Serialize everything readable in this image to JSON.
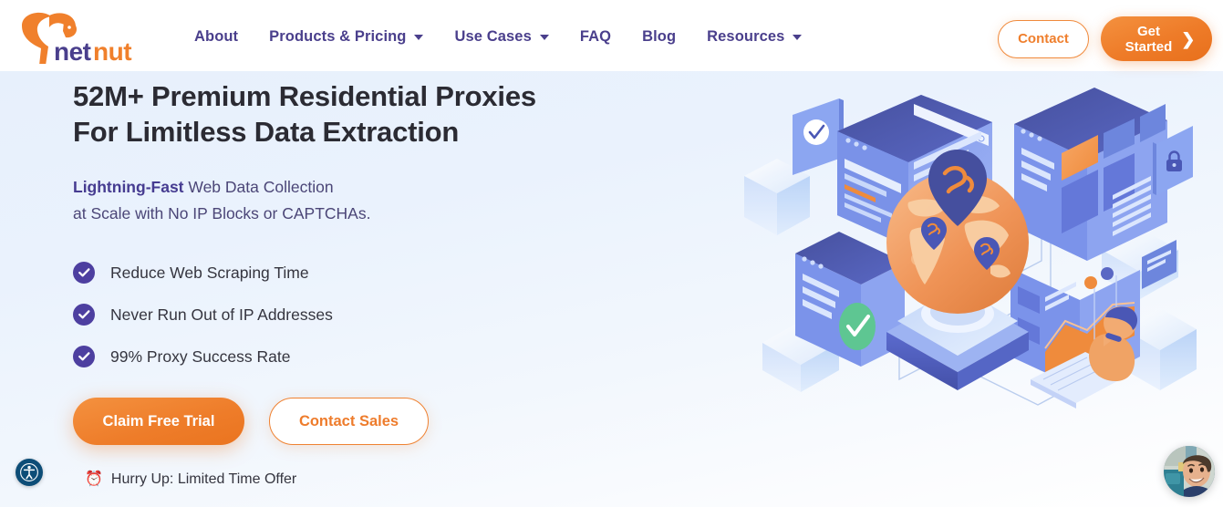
{
  "brand": {
    "name": "netnut",
    "logo_icon": "squirrel-logo",
    "name_part_one": "net",
    "name_part_two": "nut",
    "purple": "#4a3f8c",
    "orange": "#ee7c29"
  },
  "nav": {
    "items": [
      {
        "label": "About",
        "has_dropdown": false
      },
      {
        "label": "Products & Pricing",
        "has_dropdown": true
      },
      {
        "label": "Use Cases",
        "has_dropdown": true
      },
      {
        "label": "FAQ",
        "has_dropdown": false
      },
      {
        "label": "Blog",
        "has_dropdown": false
      },
      {
        "label": "Resources",
        "has_dropdown": true
      }
    ]
  },
  "header_actions": {
    "contact_label": "Contact",
    "get_started_label": "Get\nStarted",
    "get_started_line1": "Get",
    "get_started_line2": "Started",
    "chevron_icon": "chevron-right-icon"
  },
  "hero": {
    "headline_line1": "52M+ Premium Residential Proxies",
    "headline_line2": "For Limitless Data Extraction",
    "subhead_strong": "Lightning-Fast",
    "subhead_rest": " Web Data Collection",
    "subhead_line2": "at Scale with No IP Blocks or CAPTCHAs.",
    "features": [
      {
        "label": "Reduce Web Scraping Time",
        "icon": "check-circle-icon"
      },
      {
        "label": "Never Run Out of IP Addresses",
        "icon": "check-circle-icon"
      },
      {
        "label": "99% Proxy Success Rate",
        "icon": "check-circle-icon"
      }
    ],
    "cta_primary": "Claim Free Trial",
    "cta_secondary": "Contact Sales",
    "urgency_icon": "alarm-clock-emoji",
    "urgency_emoji": "⏰",
    "urgency_text": "Hurry Up: Limited Time Offer",
    "illustration_name": "isometric-global-proxy-network-illustration"
  },
  "widgets": {
    "accessibility_icon": "accessibility-person-icon",
    "chat_avatar_icon": "support-agent-avatar"
  }
}
